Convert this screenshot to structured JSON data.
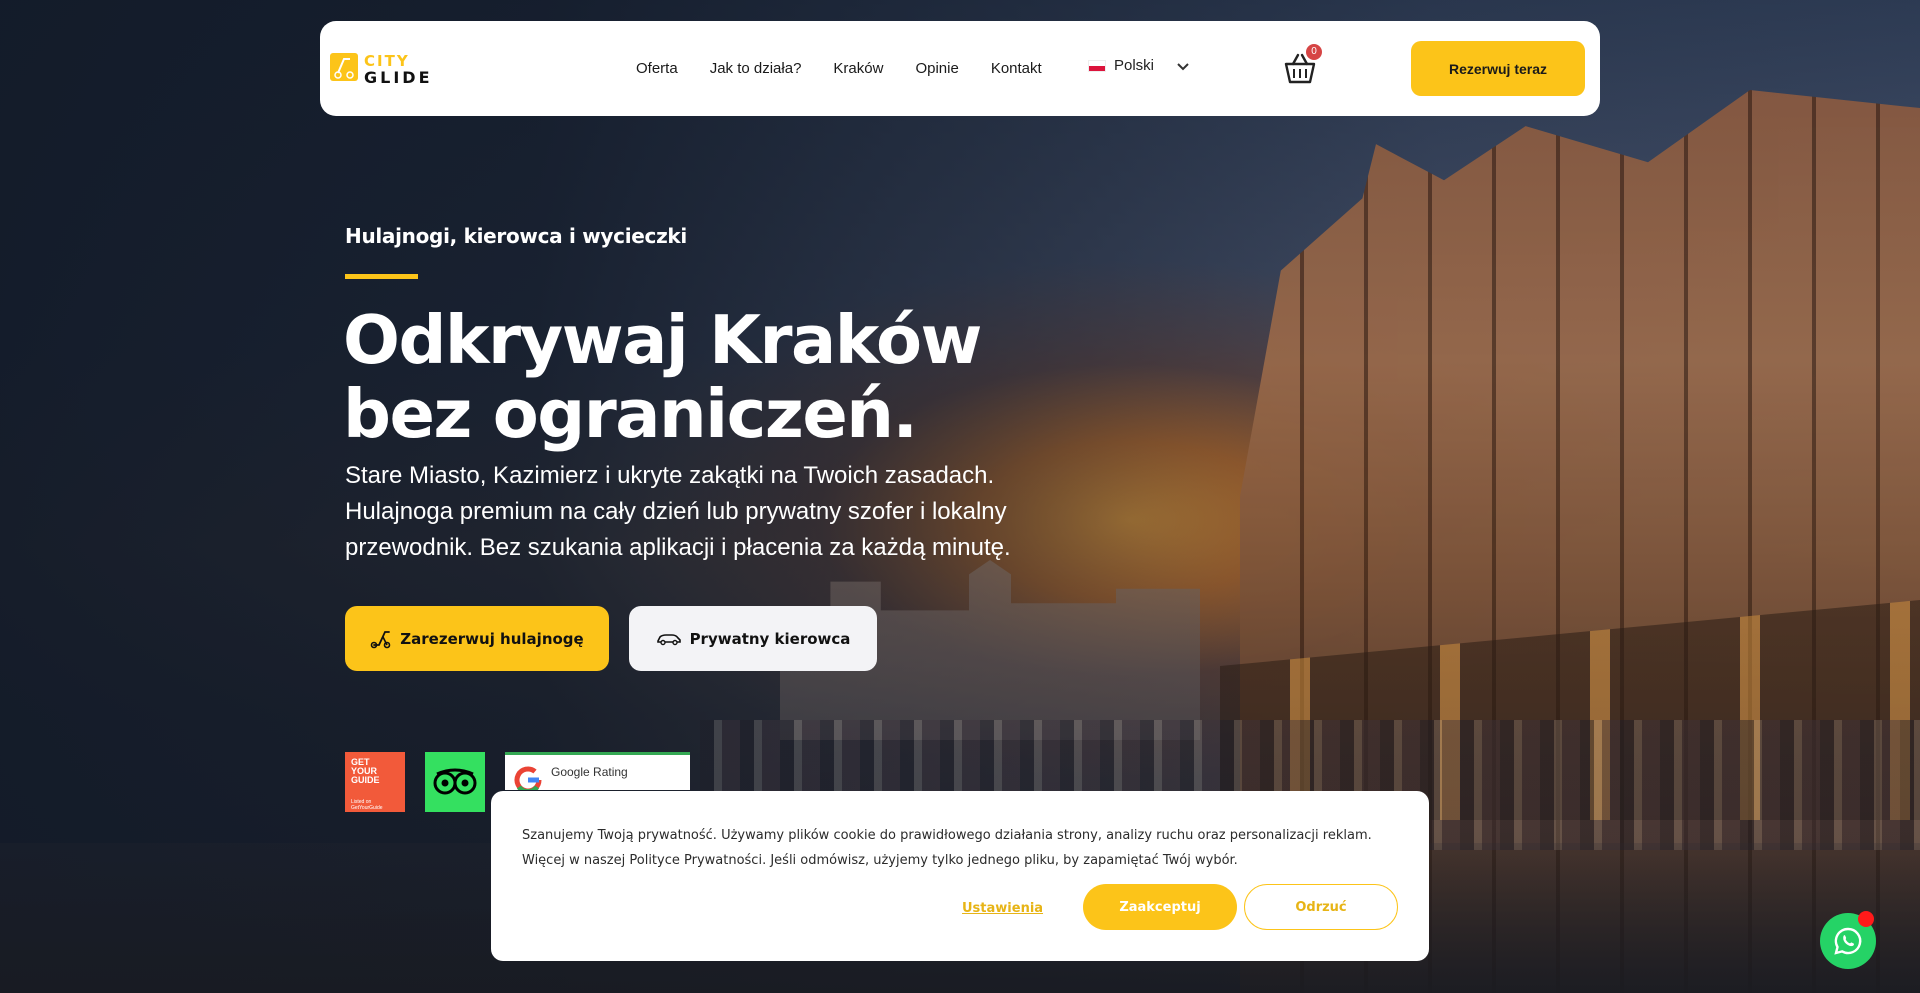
{
  "brand": {
    "logo_text_top": "CITY",
    "logo_text_bottom": "GLIDE",
    "accent_color": "#fcc419"
  },
  "nav": {
    "items": [
      {
        "label": "Oferta"
      },
      {
        "label": "Jak to działa?"
      },
      {
        "label": "Kraków"
      },
      {
        "label": "Opinie"
      },
      {
        "label": "Kontakt"
      }
    ],
    "language": {
      "label": "Polski",
      "flag": "pl-flag-icon"
    },
    "cart": {
      "icon": "basket-icon",
      "count": "0"
    },
    "book_button": "Rezerwuj teraz"
  },
  "hero": {
    "eyebrow": "Hulajnogi, kierowca i wycieczki",
    "headline_line1": "Odkrywaj Kraków",
    "headline_line2": "bez ograniczeń.",
    "subtitle": "Stare Miasto, Kazimierz i ukryte zakątki na Twoich zasadach. Hulajnoga premium na cały dzień lub prywatny szofer i lokalny przewodnik. Bez szukania aplikacji i płacenia za każdą minutę.",
    "primary_button": {
      "label": "Zarezerwuj hulajnogę",
      "icon": "scooter-icon"
    },
    "secondary_button": {
      "label": "Prywatny kierowca",
      "icon": "car-icon"
    }
  },
  "badges": {
    "getyourguide": {
      "line1": "GET",
      "line2": "YOUR",
      "line3": "GUIDE",
      "small": "Listed on GetYourGuide"
    },
    "tripadvisor": {
      "icon": "tripadvisor-owl-icon"
    },
    "google": {
      "label": "Google Rating"
    }
  },
  "cookie": {
    "text": "Szanujemy Twoją prywatność. Używamy plików cookie do prawidłowego działania strony, analizy ruchu oraz personalizacji reklam. Więcej w naszej Polityce Prywatności. Jeśli odmówisz, użyjemy tylko jednego pliku, by zapamiętać Twój wybór.",
    "settings": "Ustawienia",
    "accept": "Zaakceptuj",
    "reject": "Odrzuć"
  },
  "whatsapp": {
    "icon": "whatsapp-icon"
  }
}
